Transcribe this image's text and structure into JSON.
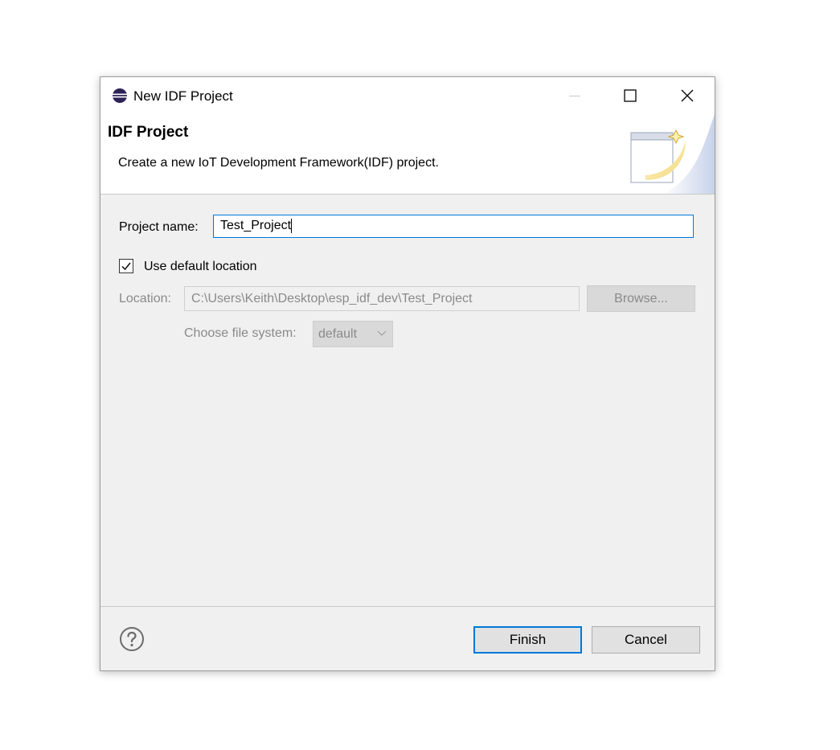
{
  "window": {
    "title": "New IDF Project",
    "app_icon": "eclipse-icon",
    "controls": [
      "minimize-icon",
      "maximize-icon",
      "close-icon"
    ]
  },
  "header": {
    "title": "IDF Project",
    "description": "Create a new IoT Development Framework(IDF) project.",
    "graphic": "wizard-banner-icon"
  },
  "form": {
    "project_name_label": "Project name:",
    "project_name_value": "Test_Project",
    "use_default_location_label": "Use default location",
    "use_default_location_checked": true,
    "location_label": "Location:",
    "location_value": "C:\\Users\\Keith\\Desktop\\esp_idf_dev\\Test_Project",
    "browse_label": "Browse...",
    "file_system_label": "Choose file system:",
    "file_system_value": "default"
  },
  "footer": {
    "help_icon": "help-icon",
    "finish_label": "Finish",
    "cancel_label": "Cancel"
  },
  "colors": {
    "accent": "#0078d7",
    "dialog_bg": "#f0f0f0",
    "disabled_text": "#8a8a8a"
  }
}
